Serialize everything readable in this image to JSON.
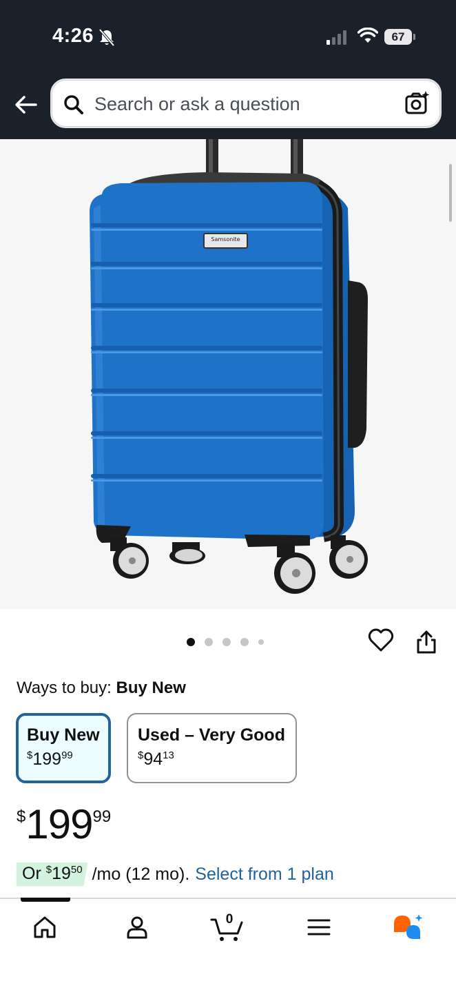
{
  "status_bar": {
    "time": "4:26",
    "battery": "67"
  },
  "header": {
    "search_placeholder": "Search or ask a question"
  },
  "product_image": {
    "brand_label": "Samsonite"
  },
  "carousel": {
    "total_dots": 5,
    "active_index": 0
  },
  "ways_to_buy": {
    "label": "Ways to buy:",
    "selected": "Buy New",
    "options": [
      {
        "title": "Buy New",
        "currency": "$",
        "whole": "199",
        "fraction": "99",
        "selected": true
      },
      {
        "title": "Used – Very Good",
        "currency": "$",
        "whole": "94",
        "fraction": "13",
        "selected": false
      }
    ]
  },
  "price": {
    "currency": "$",
    "whole": "199",
    "fraction": "99"
  },
  "monthly": {
    "or": "Or",
    "currency": "$",
    "whole": "19",
    "fraction": "50",
    "terms": "/mo (12 mo).",
    "link": "Select from 1 plan"
  },
  "bottom_nav": {
    "cart_count": "0"
  },
  "colors": {
    "header_bg": "#1a212b",
    "link": "#2162a1",
    "selected_border": "#2162a1",
    "selected_bg": "#edfdff",
    "monthly_badge": "#d4f3df",
    "luggage": "#1e72c8"
  }
}
